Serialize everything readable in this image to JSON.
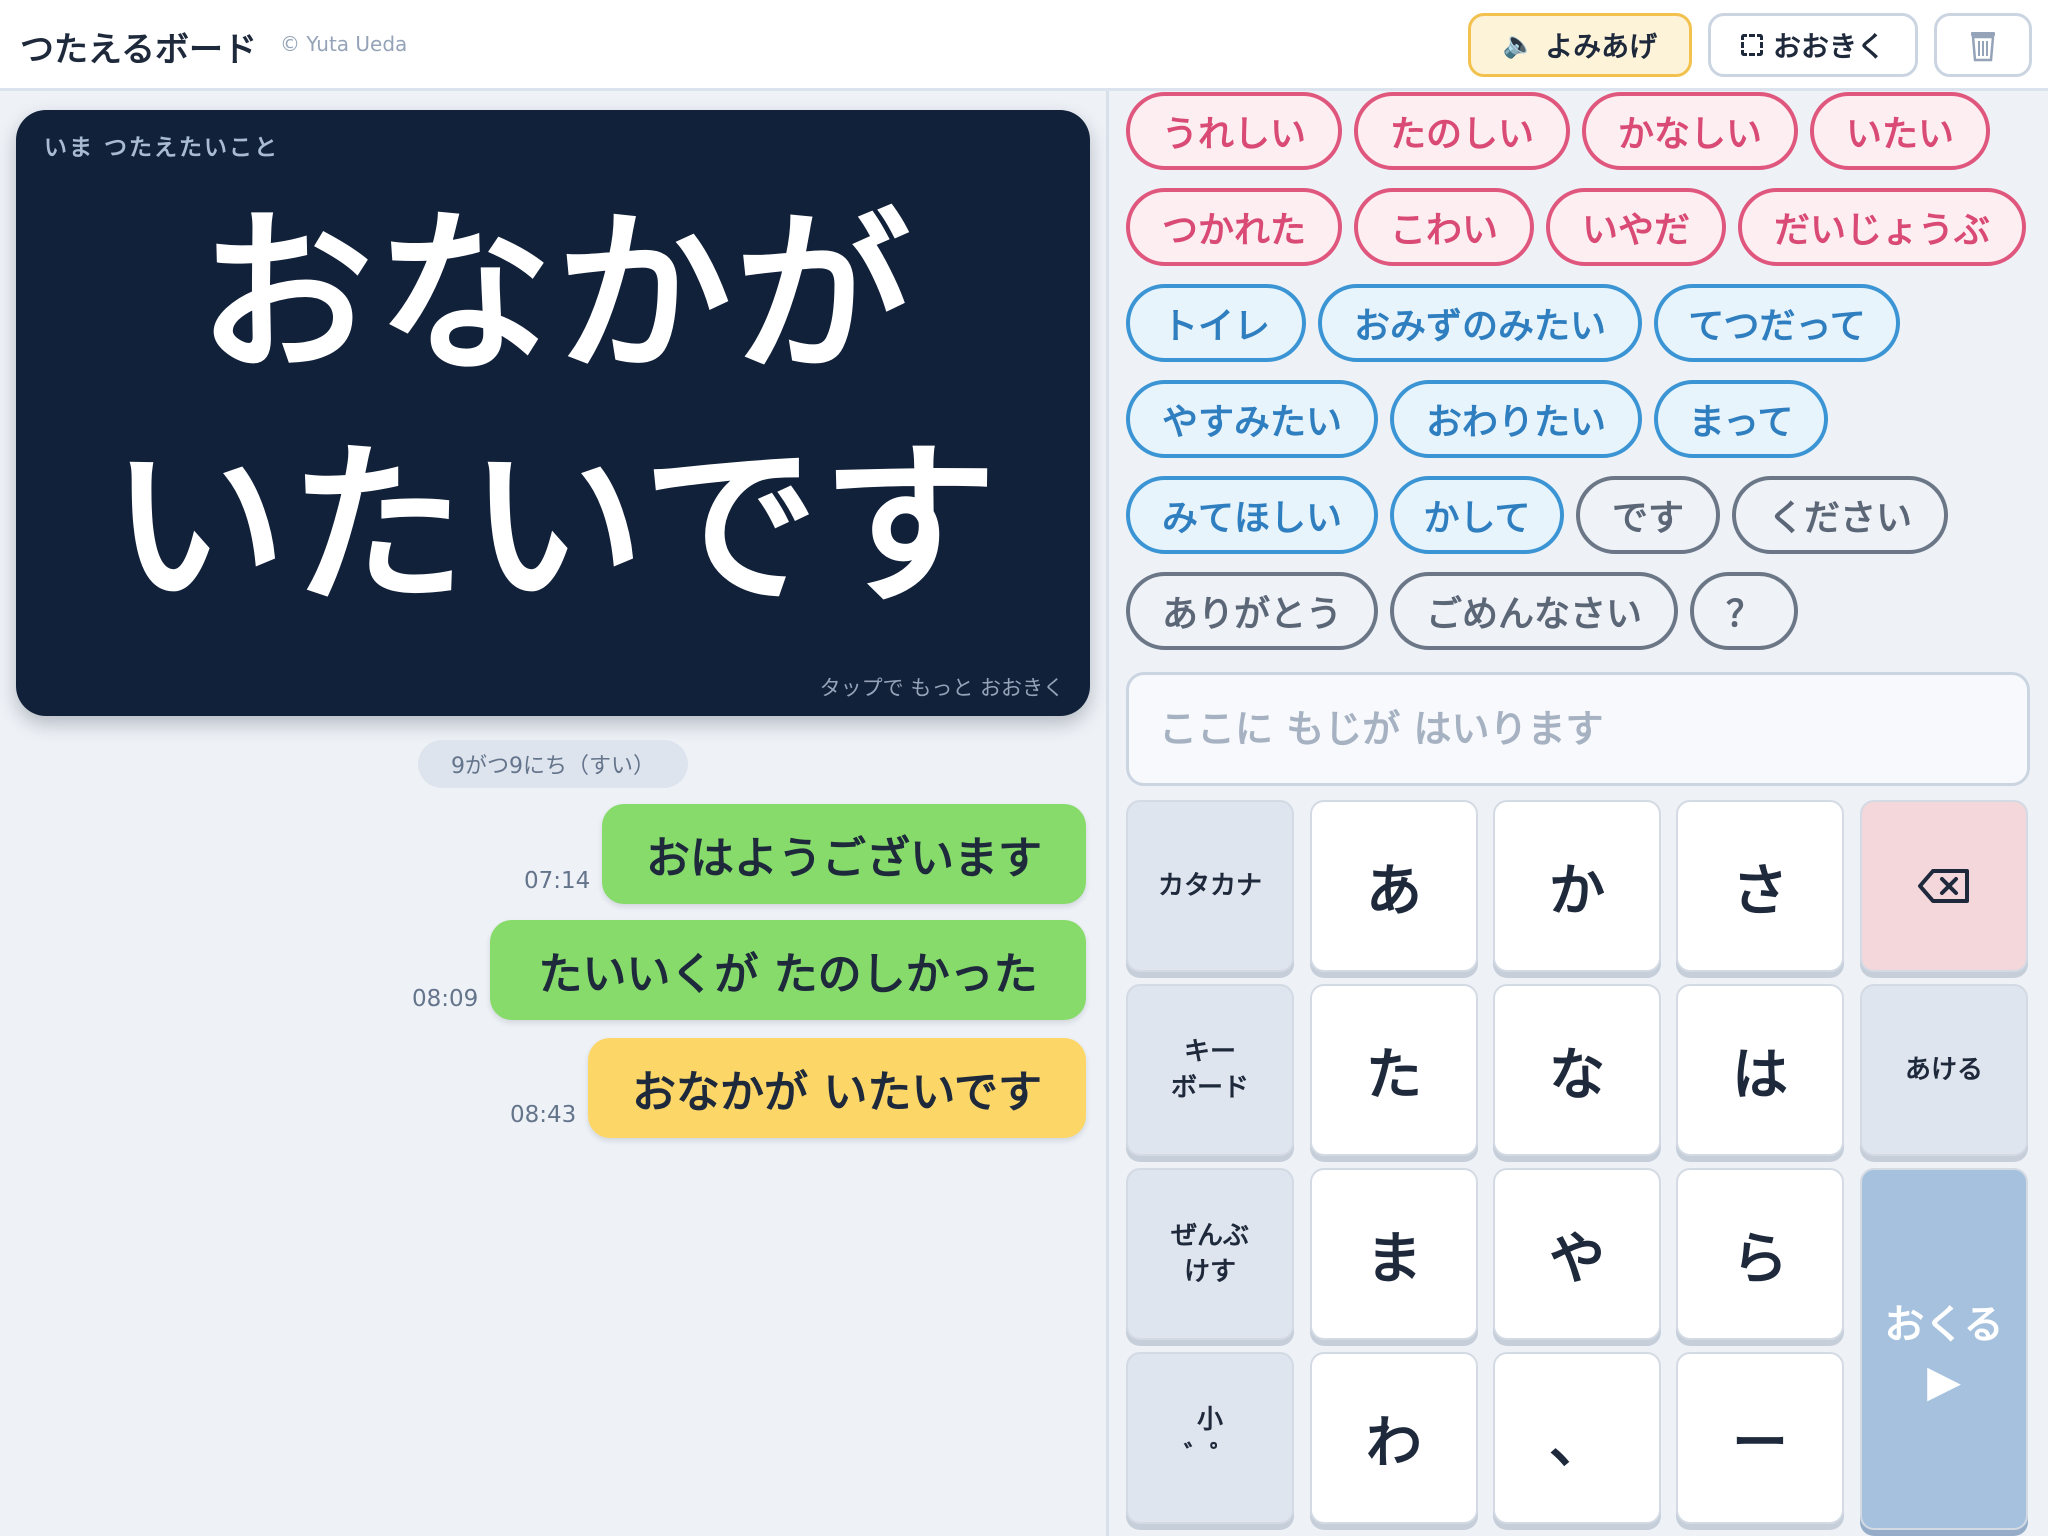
{
  "header": {
    "title": "つたえるボード",
    "credit": "© Yuta Ueda",
    "read_label": "よみあげ",
    "big_label": "おおきく",
    "speaker_icon": "speaker-icon",
    "trash_icon": "trash-icon"
  },
  "display": {
    "caption": "いま つたえたいこと",
    "text": "おなかが\nいたいです",
    "hint": "タップで もっと おおきく"
  },
  "history": {
    "date": "9がつ9にち（すい）",
    "messages": [
      {
        "time": "07:14",
        "text": "おはようございます",
        "color": "green"
      },
      {
        "time": "08:09",
        "text": "たいいくが たのしかった",
        "color": "green"
      },
      {
        "time": "08:43",
        "text": "おなかが いたいです",
        "color": "yellow"
      }
    ]
  },
  "phrases": {
    "feelings": [
      "うれしい",
      "たのしい",
      "かなしい",
      "いたい",
      "つかれた",
      "こわい",
      "いやだ",
      "だいじょうぶ"
    ],
    "requests": [
      "トイレ",
      "おみずのみたい",
      "てつだって",
      "やすみたい",
      "おわりたい",
      "まって",
      "みてほしい",
      "かして"
    ],
    "words": [
      "です",
      "ください",
      "ありがとう",
      "ごめんなさい",
      "？"
    ]
  },
  "input": {
    "placeholder": "ここに もじが はいります",
    "value": ""
  },
  "keyboard": {
    "katakana": "カタカナ",
    "keyboard": "キー\nボード",
    "clear": "ぜんぶ\nけす",
    "small": "小\n゛゜",
    "space": "あける",
    "send": "おくる",
    "send_arrow": "▶",
    "backspace_icon": "backspace-icon",
    "keys": [
      "あ",
      "か",
      "さ",
      "た",
      "な",
      "は",
      "ま",
      "や",
      "ら",
      "わ",
      "、",
      "ー"
    ]
  },
  "colors": {
    "display_bg": "#12213a",
    "green_bubble": "#86db6a",
    "yellow_bubble": "#fcd768",
    "pink_chip": "#e0577e",
    "blue_chip": "#3b94d4",
    "send_key": "#a5c1de"
  }
}
